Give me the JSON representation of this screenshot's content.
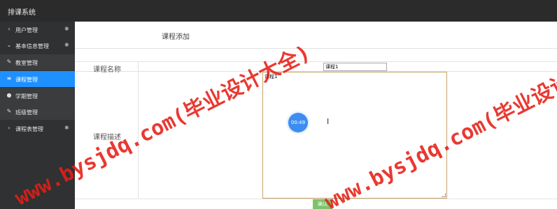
{
  "app": {
    "title": "排课系统"
  },
  "sidebar": {
    "items": [
      {
        "icon": "chevron-right-icon",
        "label": "用户管理",
        "has_gear": true
      },
      {
        "icon": "chevron-down-icon",
        "label": "基本信息管理",
        "has_gear": true
      },
      {
        "icon": "pencil-icon",
        "label": "教室管理"
      },
      {
        "icon": "list-icon",
        "label": "课程管理",
        "active": true
      },
      {
        "icon": "globe-icon",
        "label": "学期管理"
      },
      {
        "icon": "pencil-icon",
        "label": "班级管理"
      },
      {
        "icon": "chevron-right-icon",
        "label": "课程表管理",
        "has_gear": true
      }
    ]
  },
  "form": {
    "page_title": "课程添加",
    "name_label": "课程名称",
    "name_value": "课程1",
    "desc_label": "课程描述",
    "desc_value": "课程1",
    "submit_label": "确认"
  },
  "overlay": {
    "timer": "00:49",
    "watermark": "www.bysjdq.com(毕业设计大全)"
  },
  "colors": {
    "accent": "#1e90ff",
    "topbar": "#2b2b2b",
    "sidebar": "#2f3133",
    "button": "#7cc36b",
    "watermark": "#e61e14"
  }
}
